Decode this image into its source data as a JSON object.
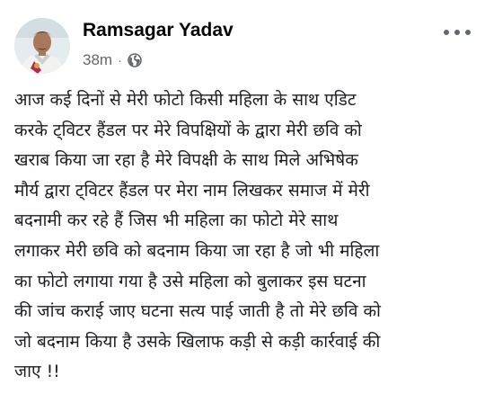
{
  "post": {
    "author": {
      "name": "Ramsagar Yadav",
      "avatar_icon": "profile-photo-icon"
    },
    "timestamp": "38m",
    "separator": "·",
    "privacy_icon": "globe-icon",
    "more_icon": "more-options-icon",
    "text_lines": [
      "आज कई दिनों से मेरी फोटो किसी महिला के साथ एडिट",
      "करके ट्विटर हैंडल पर मेरे विपक्षियों के द्वारा मेरी छवि को",
      "खराब किया जा रहा है मेरे विपक्षी के साथ मिले अभिषेक",
      "मौर्य द्वारा ट्विटर हैंडल पर मेरा नाम लिखकर समाज में मेरी",
      "बदनामी कर रहे हैं जिस भी महिला का फोटो मेरे साथ",
      "लगाकर मेरी छवि को बदनाम किया जा रहा है जो भी महिला",
      "का फोटो लगाया गया है उसे महिला को बुलाकर इस घटना",
      "की जांच कराई जाए घटना सत्य पाई जाती है तो मेरे छवि को",
      "जो बदनाम किया है उसके खिलाफ कड़ी से कड़ी कार्रवाई की",
      "जाए !!"
    ]
  },
  "colors": {
    "text_primary": "#050505",
    "text_secondary": "#65676b",
    "background": "#ffffff"
  }
}
